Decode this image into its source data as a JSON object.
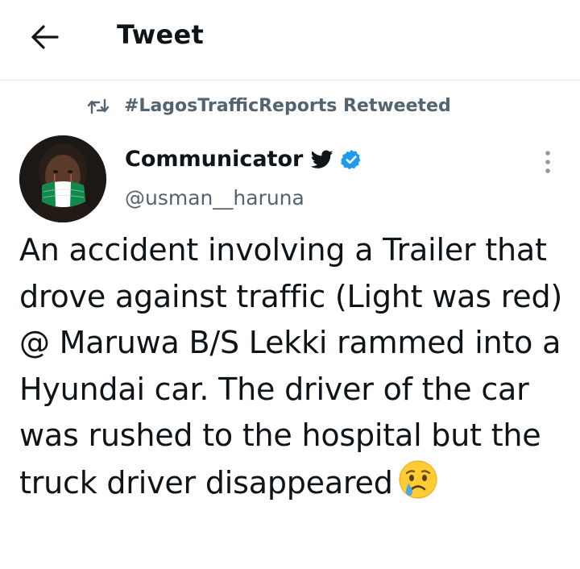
{
  "header": {
    "title": "Tweet",
    "back_icon": "arrow-left-icon"
  },
  "retweet": {
    "icon": "retweet-icon",
    "text": "#LagosTrafficReports Retweeted"
  },
  "author": {
    "name": "Communicator",
    "handle": "@usman__haruna",
    "badges": [
      "twitter-bird-icon",
      "verified-badge-icon"
    ]
  },
  "tweet": {
    "text": "An accident involving a Trailer that drove against traffic (Light was red) @ Maruwa B/S Lekki rammed into a Hyundai car. The driver of the car was rushed to the hospital but the truck driver disappeared",
    "trailing_emoji": "crying-face-emoji"
  },
  "colors": {
    "text_primary": "#0f1419",
    "text_secondary": "#536471",
    "verified_blue": "#1d9bf0",
    "divider": "#e6e9ec"
  }
}
